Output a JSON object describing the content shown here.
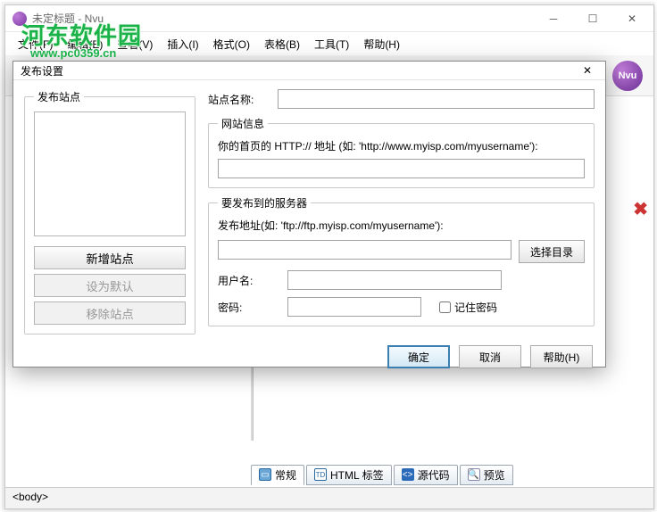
{
  "window": {
    "title": "未定标题 - Nvu",
    "logo_text": "Nvu"
  },
  "menu": {
    "file": "文件(F)",
    "edit": "编辑(E)",
    "view": "查看(V)",
    "insert": "插入(I)",
    "format": "格式(O)",
    "table": "表格(B)",
    "tools": "工具(T)",
    "help": "帮助(H)"
  },
  "watermark": {
    "brand": "河东软件园",
    "url": "www.pc0359.cn"
  },
  "dialog": {
    "title": "发布设置",
    "sites_group": "发布站点",
    "add_site": "新增站点",
    "set_default": "设为默认",
    "remove_site": "移除站点",
    "site_name_label": "站点名称:",
    "website_group": "网站信息",
    "homepage_label": "你的首页的 HTTP:// 地址 (如: 'http://www.myisp.com/myusername'):",
    "server_group": "要发布到的服务器",
    "publish_addr_label": "发布地址(如: 'ftp://ftp.myisp.com/myusername'):",
    "choose_dir": "选择目录",
    "username_label": "用户名:",
    "password_label": "密码:",
    "remember_pw": "记住密码",
    "ok": "确定",
    "cancel": "取消",
    "help": "帮助(H)"
  },
  "bottom_tabs": {
    "normal": "常规",
    "html_tags": "HTML 标签",
    "source": "源代码",
    "preview": "预览"
  },
  "statusbar": {
    "path": "<body>"
  }
}
